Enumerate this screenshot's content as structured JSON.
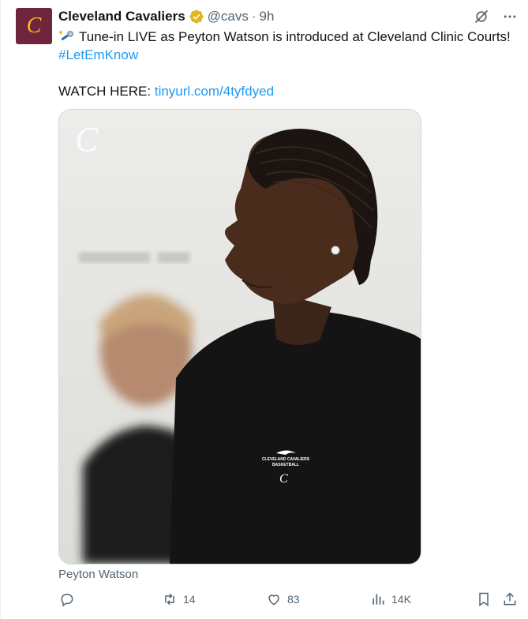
{
  "tweet": {
    "display_name": "Cleveland Cavaliers",
    "handle": "@cavs",
    "separator": "·",
    "timestamp": "9h",
    "text_line1": "Tune-in LIVE as Peyton Watson is introduced at Cleveland Clinic Courts!",
    "hashtag": "#LetEmKnow",
    "watch_label": "WATCH HERE:",
    "watch_link": "tinyurl.com/4tyfdyed",
    "media_caption": "Peyton Watson",
    "shirt_line1": "CLEVELAND CAVALIERS",
    "shirt_line2": "BASKETBALL"
  },
  "avatar": {
    "letter": "C",
    "bg_color": "#6f263d",
    "letter_color": "#ffb81c"
  },
  "icons": {
    "verified": "verified-badge-icon",
    "grok": "grok-icon",
    "more": "more-icon",
    "reply": "reply-icon",
    "retweet": "retweet-icon",
    "like": "like-icon",
    "views": "views-icon",
    "bookmark": "bookmark-icon",
    "share": "share-icon"
  },
  "actions": {
    "retweets": "14",
    "likes": "83",
    "views": "14K"
  },
  "colors": {
    "text": "#0f1419",
    "secondary": "#536471",
    "link": "#1d9bf0",
    "verified": "#e2b719"
  }
}
